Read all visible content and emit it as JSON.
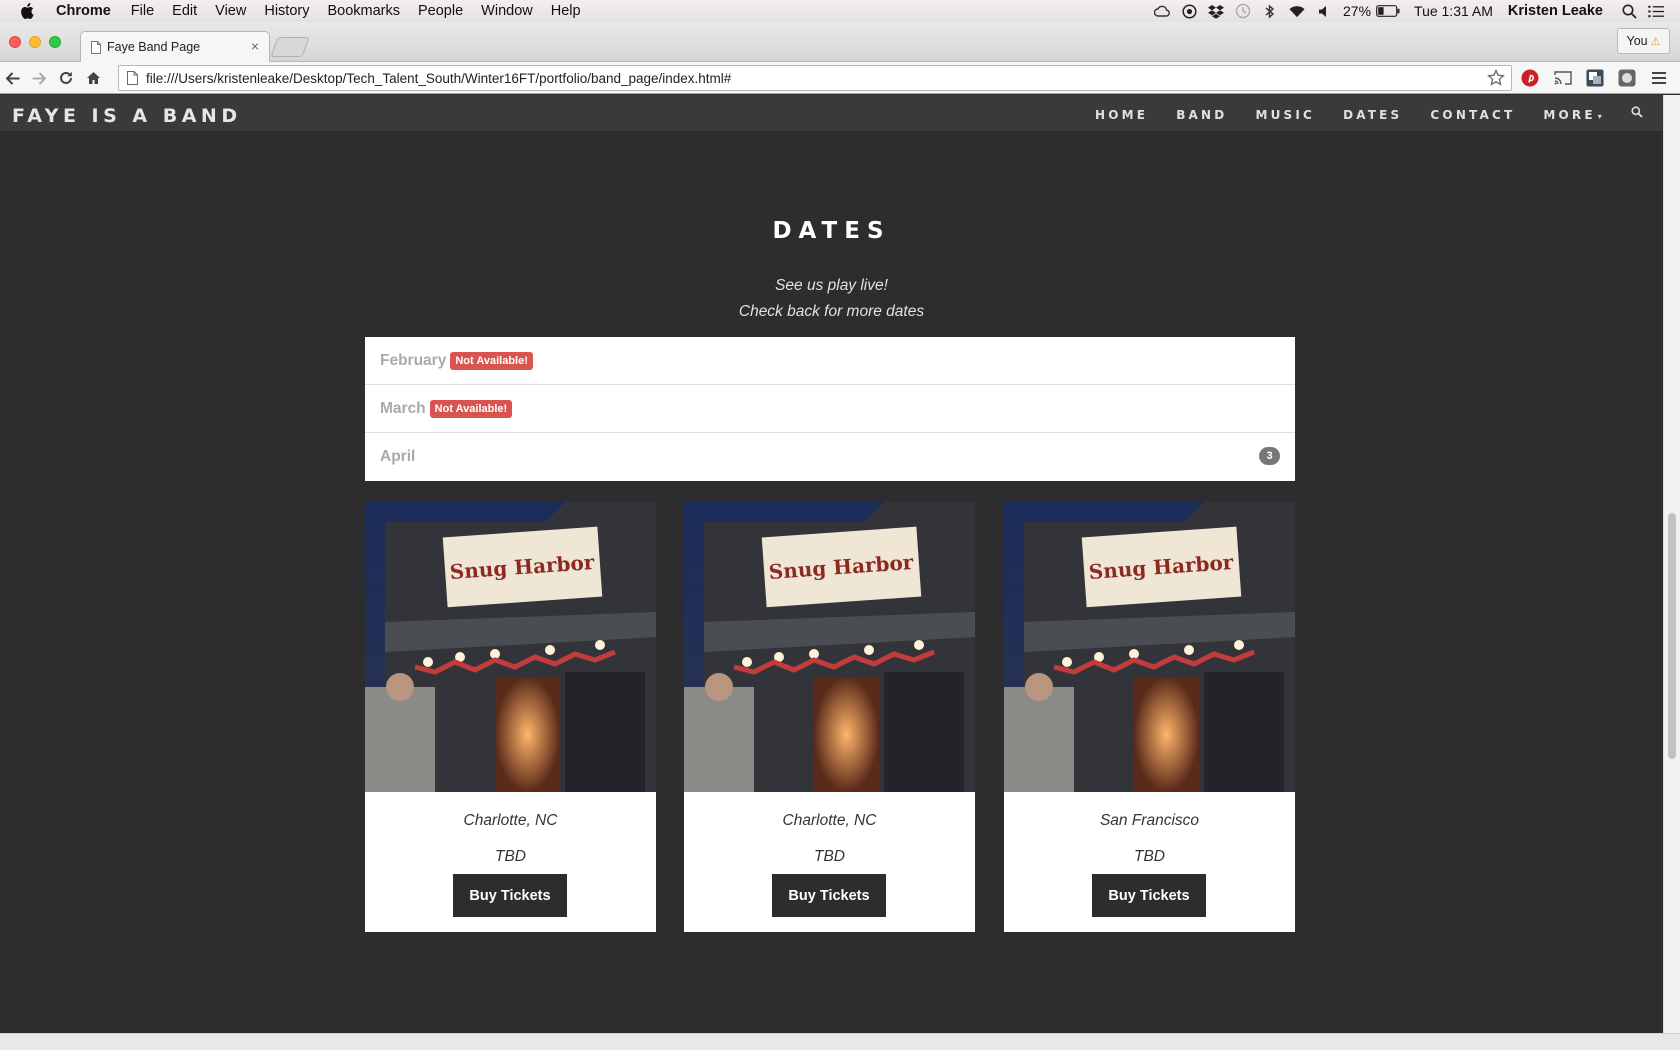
{
  "macos_menubar": {
    "app_name": "Chrome",
    "menus": [
      "File",
      "Edit",
      "View",
      "History",
      "Bookmarks",
      "People",
      "Window",
      "Help"
    ],
    "battery": "27%",
    "clock": "Tue 1:31 AM",
    "user": "Kristen Leake"
  },
  "browser": {
    "tab_title": "Faye Band Page",
    "tab_close": "×",
    "profile_label": "You",
    "profile_warning": "⚠",
    "url": "file:///Users/kristenleake/Desktop/Tech_Talent_South/Winter16FT/portfolio/band_page/index.html#"
  },
  "site": {
    "brand": "FAYE IS A BAND",
    "nav": [
      "HOME",
      "BAND",
      "MUSIC",
      "DATES",
      "CONTACT",
      "MORE"
    ],
    "more_caret": "▾"
  },
  "dates_section": {
    "title": "DATES",
    "subtitle_line1": "See us play live!",
    "subtitle_line2": "Check back for more dates",
    "months": [
      {
        "name": "February",
        "badge": "Not Available!"
      },
      {
        "name": "March",
        "badge": "Not Available!"
      },
      {
        "name": "April",
        "count": "3"
      }
    ],
    "shows": [
      {
        "city": "Charlotte, NC",
        "date": "TBD",
        "button": "Buy Tickets",
        "sign_text": "Snug Harbor"
      },
      {
        "city": "Charlotte, NC",
        "date": "TBD",
        "button": "Buy Tickets",
        "sign_text": "Snug Harbor"
      },
      {
        "city": "San Francisco",
        "date": "TBD",
        "button": "Buy Tickets",
        "sign_text": "Snug Harbor"
      }
    ]
  },
  "colors": {
    "page_bg": "#2d2d30",
    "nav_bg": "#3a3a3d",
    "badge_red": "#d9534f",
    "count_badge": "#777777"
  }
}
